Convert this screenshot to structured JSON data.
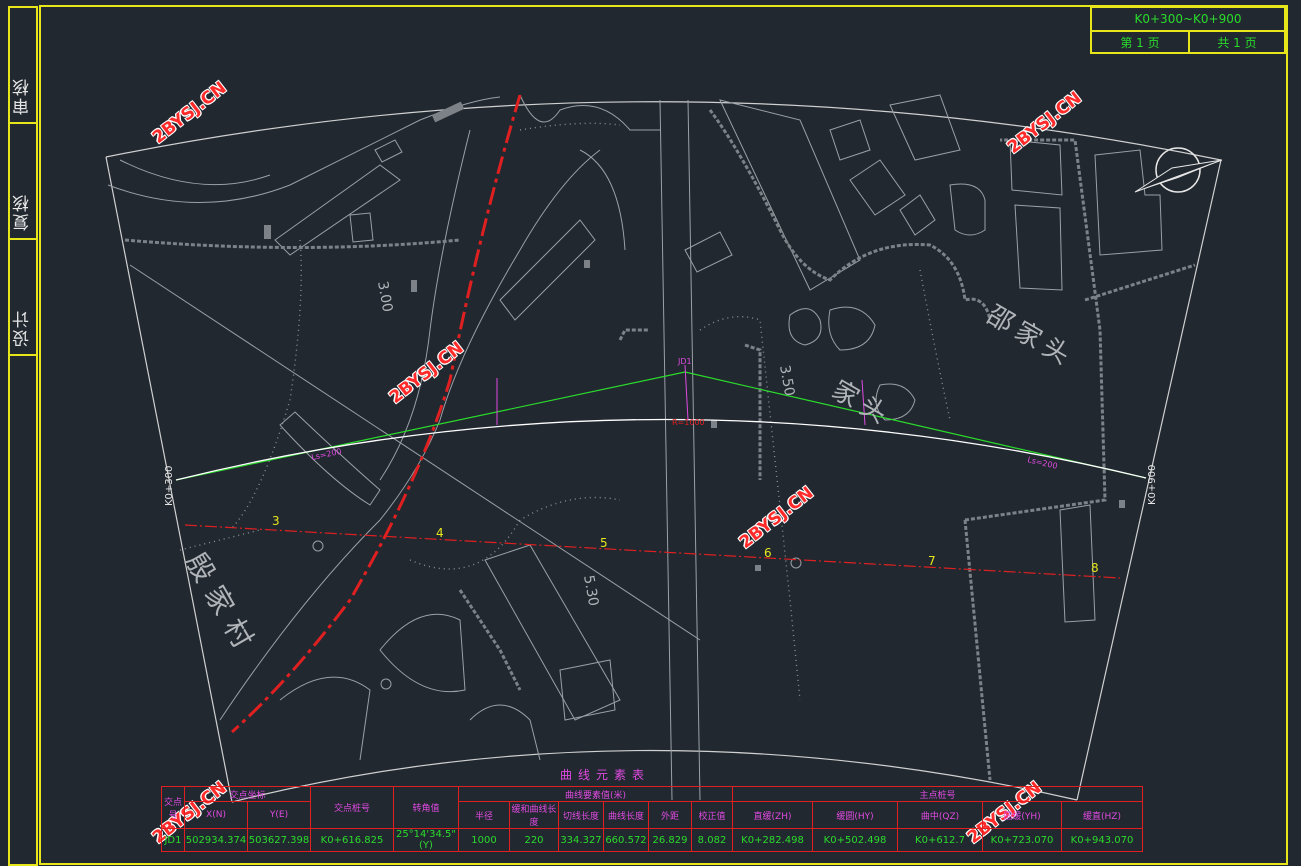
{
  "sidebar": {
    "labels": [
      "审核",
      "复核",
      "设计"
    ]
  },
  "title_block": {
    "range": "K0+300~K0+900",
    "page_label": "第 1 页",
    "total_label": "共 1 页"
  },
  "watermark": "2BYSJ.CN",
  "map_labels": {
    "village_left": "殷家村",
    "village_right": "邵家头",
    "village_center": "家头",
    "elev_1": "3.00",
    "elev_2": "3.50",
    "elev_3": "5.30",
    "chain_start": "K0+300",
    "chain_end": "K0+900",
    "stations": [
      "3",
      "4",
      "5",
      "6",
      "7",
      "8"
    ],
    "ls_left": "Ls=200",
    "ls_right": "Ls=200",
    "radius": "R=1000",
    "jd": "JD1"
  },
  "curve_table": {
    "title": "曲线元素表",
    "h_jd_no": "交点号",
    "h_coords": "交点坐标",
    "h_x": "X(N)",
    "h_y": "Y(E)",
    "h_station": "交点桩号",
    "h_angle": "转角值",
    "h_elements": "曲线要素值(米)",
    "h_radius": "半径",
    "h_spiral": "缓和曲线长度",
    "h_tangent": "切线长度",
    "h_curve_len": "曲线长度",
    "h_external": "外距",
    "h_correction": "校正值",
    "h_main_points": "主点桩号",
    "h_zh": "直缓(ZH)",
    "h_hy": "缓圆(HY)",
    "h_qz": "曲中(QZ)",
    "h_yh": "圆缓(YH)",
    "h_hz": "缓直(HZ)",
    "row": {
      "jd": "JD1",
      "x": "502934.374",
      "y": "503627.398",
      "station": "K0+616.825",
      "angle": "25°14'34.5\"(Y)",
      "radius": "1000",
      "spiral": "220",
      "tangent": "334.327",
      "curve_len": "660.572",
      "external": "26.829",
      "correction": "8.082",
      "zh": "K0+282.498",
      "hy": "K0+502.498",
      "qz": "K0+612.7",
      "yh": "K0+723.070",
      "hz": "K0+943.070"
    }
  },
  "colors": {
    "frame": "#e6e61a",
    "map_lines": "#c8c8c8",
    "alignment_green": "#2bdb2b",
    "red_line": "#e02020",
    "magenta": "#e04ae0",
    "yellow_text": "#e6e61a"
  }
}
